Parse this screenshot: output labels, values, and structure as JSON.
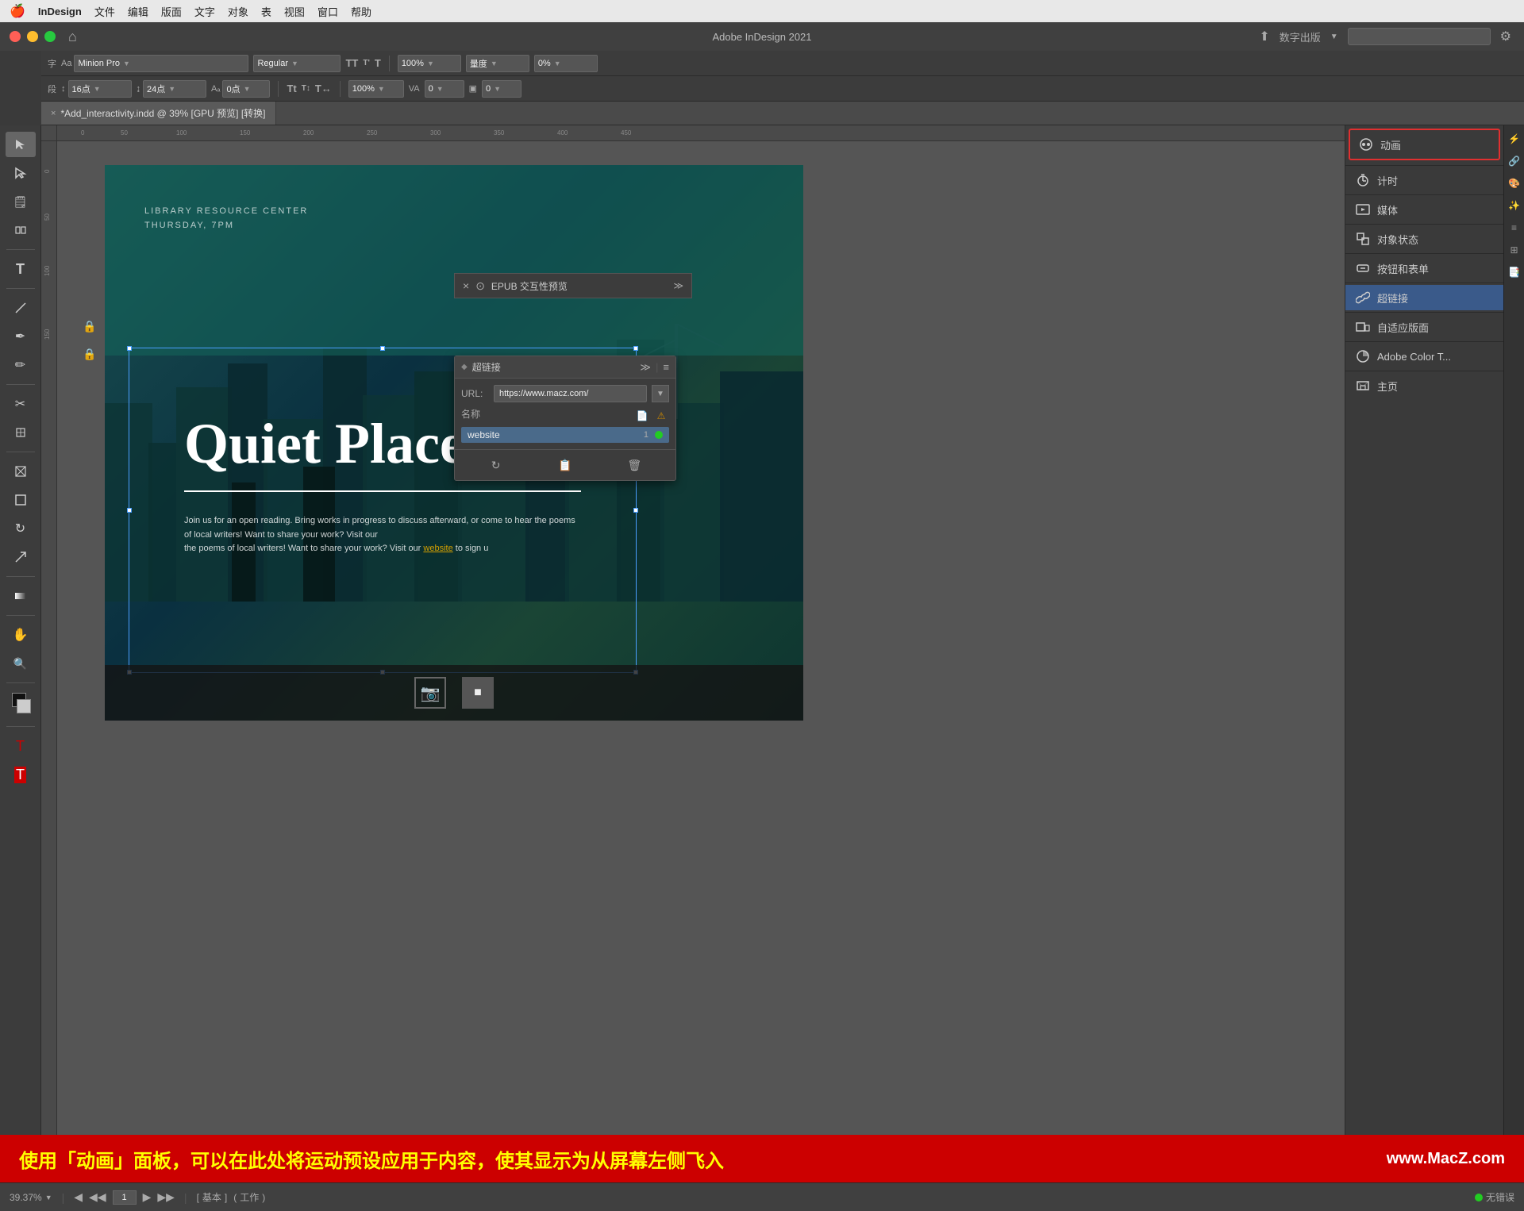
{
  "app": {
    "title": "Adobe InDesign 2021",
    "menu_items": [
      "🍎",
      "InDesign",
      "文件",
      "编辑",
      "版面",
      "文字",
      "对象",
      "表",
      "视图",
      "窗口",
      "帮助"
    ]
  },
  "toolbar": {
    "title": "Adobe InDesign 2021",
    "share_label": "数字出版",
    "search_placeholder": ""
  },
  "propbar1": {
    "font_name": "Minion Pro",
    "font_style": "Regular",
    "tt_label1": "TT",
    "tt_label2": "T'",
    "tt_label3": "T",
    "size_label": "100%",
    "metric_label": "量度",
    "kern_label": "0%"
  },
  "propbar2": {
    "size_pt": "16点",
    "lead_pt": "24点",
    "tracking_pt": "0点",
    "scale1": "100%",
    "kern2": "0",
    "bl_shift": "0"
  },
  "doc_tab": {
    "close": "×",
    "title": "*Add_interactivity.indd @ 39% [GPU 预览] [转换]"
  },
  "canvas": {
    "page_content": {
      "header_line1": "LIBRARY RESOURCE CENTER",
      "header_line2": "THURSDAY, 7PM",
      "title": "Quiet Places",
      "body_text": "Join us for an open reading. Bring works in progress to discuss afterward, or come to hear the poems of local writers! Want to share your work? Visit our",
      "link_text": "website",
      "body_text2": "to sign u"
    }
  },
  "epub_bar": {
    "icon": "⊙",
    "label": "EPUB 交互性预览",
    "expand": "≫"
  },
  "hyperlink_panel": {
    "title": "超链接",
    "expand": "≫",
    "menu": "≡",
    "url_label": "URL:",
    "url_value": "https://www.macz.com/",
    "name_label": "名称",
    "entry_name": "website",
    "entry_num": "1",
    "status": "●"
  },
  "right_panel": {
    "animation_label": "动画",
    "timer_label": "计时",
    "media_label": "媒体",
    "object_state_label": "对象状态",
    "button_form_label": "按钮和表单",
    "hyperlink_label": "超链接",
    "adaptive_label": "自适应版面",
    "color_theme_label": "Adobe Color T...",
    "home_label": "主页"
  },
  "status_bar": {
    "zoom_label": "39.37%",
    "page_label": "1",
    "mode_label": "基本",
    "work_label": "工作",
    "error_label": "无错误"
  },
  "bottom_banner": {
    "text": "使用「动画」面板，可以在此处将运动预设应用于内容，使其显示为从屏幕左侧飞入",
    "url": "www.MacZ.com"
  },
  "icons": {
    "arrow_select": "↖",
    "direct_select": "↗",
    "page_tool": "📄",
    "gap_tool": "⊞",
    "type_tool": "T",
    "line_tool": "/",
    "pen_tool": "✒",
    "pencil_tool": "✏",
    "scissors": "✂",
    "free_transform": "⊡",
    "rect_frame": "⊟",
    "rect_tool": "□",
    "rotate_tool": "↻",
    "scale_tool": "⤢",
    "gradient_tool": "▥",
    "hand_tool": "✋",
    "zoom_tool": "🔍",
    "fill_stroke": "■",
    "apply_color": "▲",
    "format_text": "T"
  }
}
